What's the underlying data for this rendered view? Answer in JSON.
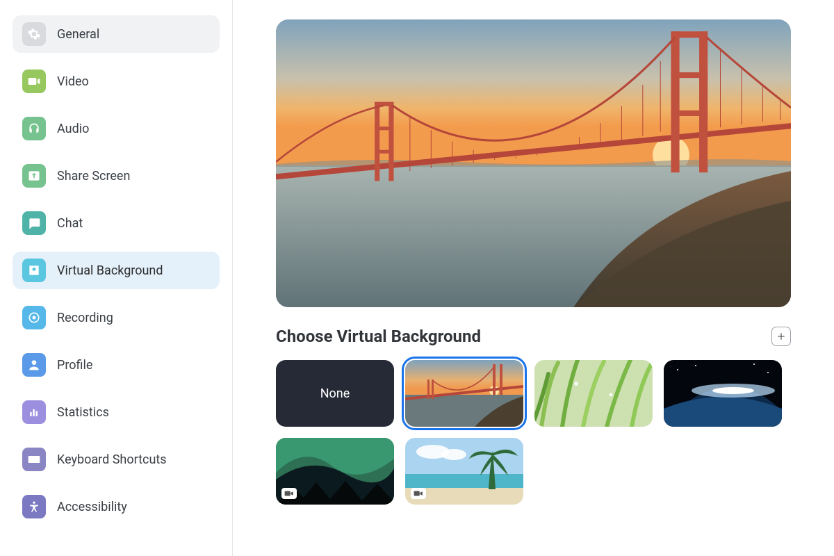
{
  "sidebar": {
    "items": [
      {
        "label": "General"
      },
      {
        "label": "Video"
      },
      {
        "label": "Audio"
      },
      {
        "label": "Share Screen"
      },
      {
        "label": "Chat"
      },
      {
        "label": "Virtual Background"
      },
      {
        "label": "Recording"
      },
      {
        "label": "Profile"
      },
      {
        "label": "Statistics"
      },
      {
        "label": "Keyboard Shortcuts"
      },
      {
        "label": "Accessibility"
      }
    ]
  },
  "main": {
    "section_title": "Choose Virtual Background",
    "thumbs": {
      "none_label": "None",
      "options": [
        {
          "name": "none"
        },
        {
          "name": "golden-gate-bridge",
          "selected": true
        },
        {
          "name": "grass"
        },
        {
          "name": "earth-from-space"
        },
        {
          "name": "aurora",
          "is_video": true
        },
        {
          "name": "beach",
          "is_video": true
        }
      ]
    }
  }
}
